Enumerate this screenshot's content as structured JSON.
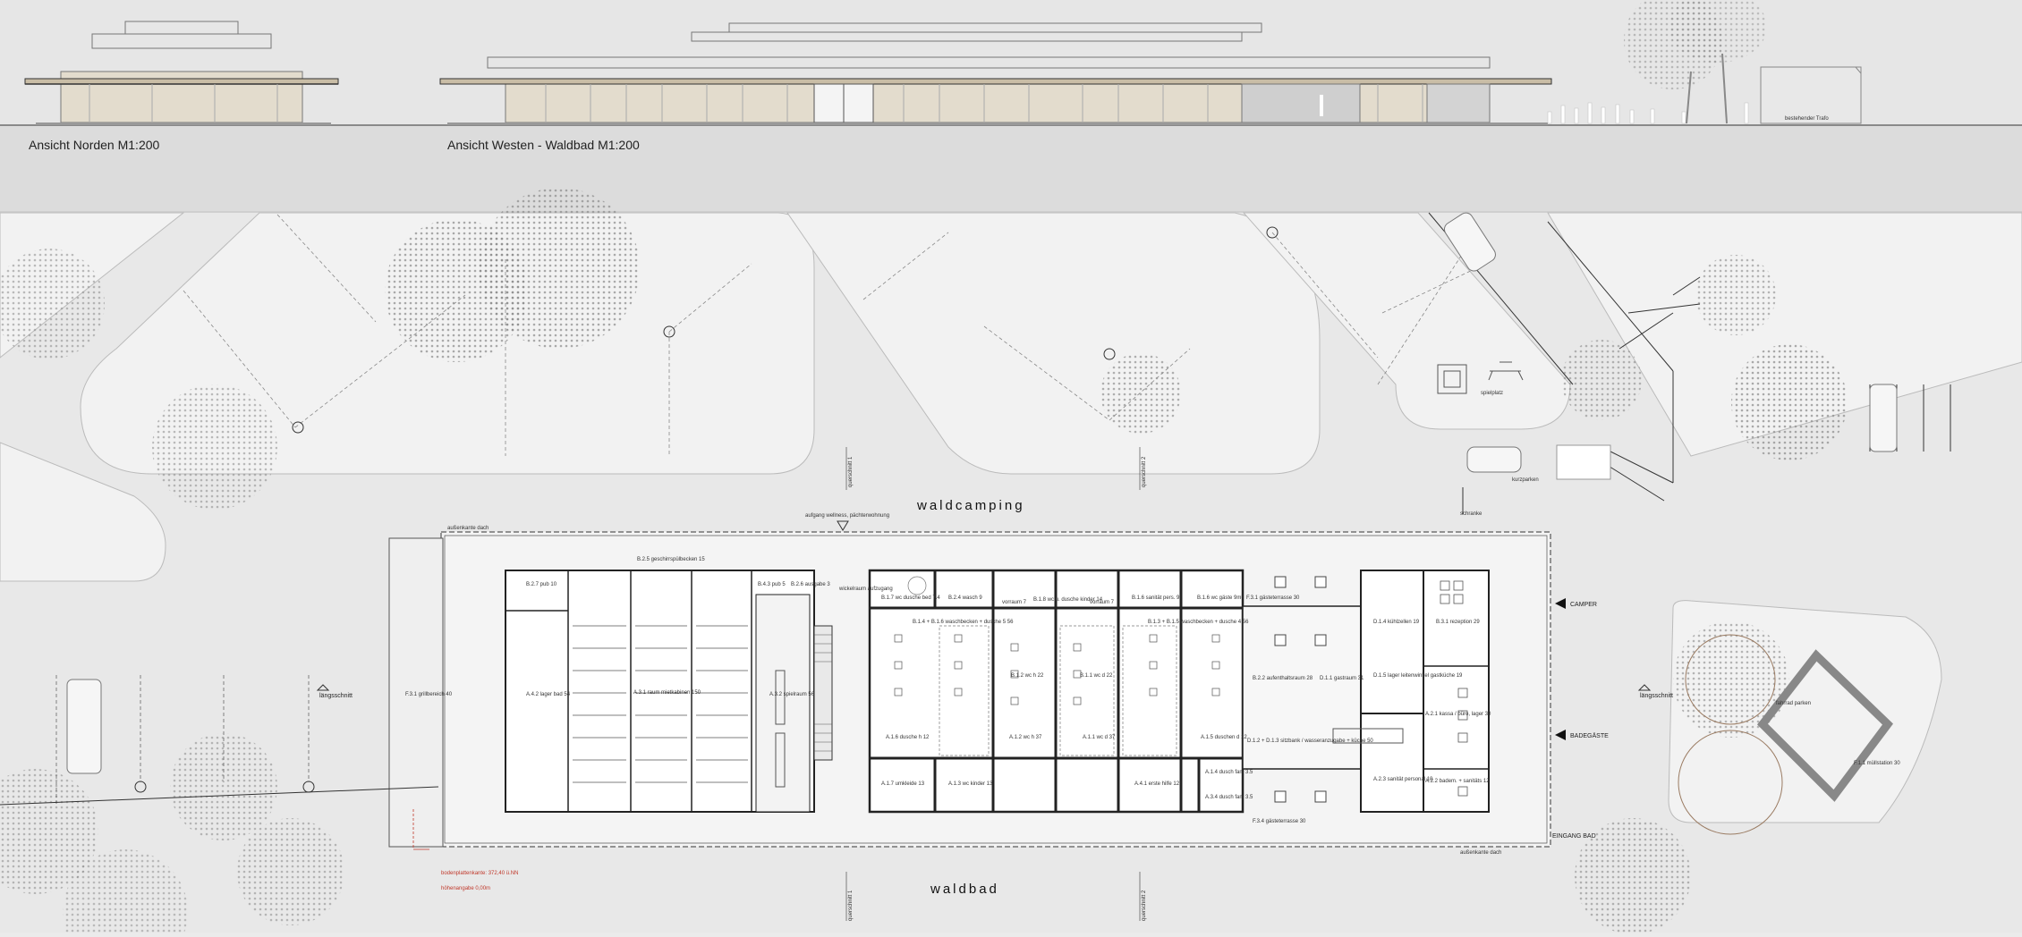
{
  "elevations": {
    "north_title": "Ansicht Norden  M1:200",
    "west_title": "Ansicht Westen - Waldbad  M1:200",
    "trafo_label": "bestehender Trafo"
  },
  "site": {
    "waldcamping": "waldcamping",
    "waldbad": "waldbad",
    "camper": "CAMPER",
    "badegaeste": "BADEGÄSTE",
    "eingang_bad": "EINGANG BAD",
    "aussenkante_top": "außenkante dach",
    "aussenkante_bottom": "außenkante dach",
    "zugang_label": "aufgang wellness, pächterwohnung",
    "schranke": "schranke",
    "spielplatz": "spielplatz",
    "kurzparken": "kurzparken",
    "laengsschnitt_left": "längsschnitt",
    "laengsschnitt_right": "längsschnitt",
    "querschnitt1_top": "querschnitt 1",
    "querschnitt2_top": "querschnitt 2",
    "querschnitt1_bottom": "querschnitt 1",
    "querschnitt2_bottom": "querschnitt 2",
    "red_note_1": "bodenplattenkante: 372,40 ü.NN",
    "red_note_2": "höhenangabe 0,00m"
  },
  "rooms": {
    "b27": "B.2.7 pub 10",
    "b25": "B.2.5 geschirrspülbecken 15",
    "b43": "B.4.3 pub 5",
    "b26": "B.2.6 ausgabe 3",
    "a42": "A.4.2 lager bad 54",
    "a31": "A.3.1 raum mietkabinen 150",
    "a32": "A.3.2 spielraum 56",
    "wickel": "wickelraum aufzugang",
    "b17": "B.1.7 wc dusche bed 7.4",
    "b24": "B.2.4 wasch 9",
    "vorraum1": "vorraum 7",
    "b18": "B.1.8 wc u. dusche kinder 14",
    "vorraum2": "vorraum 7",
    "b16": "B.1.6 sanität pers. 9",
    "b15": "B.1.6 wc gäste 9m²",
    "f31": "F.3.1 gästeterrasse 30",
    "b14": "B.1.4 + B.1.6 waschbecken + dusche 5 56",
    "b13": "B.1.3 + B.1.5 waschbecken + dusche 4 56",
    "b12": "B.1.2 wc h 22",
    "b11": "B.1.1 wc d 22",
    "a16": "A.1.6 dusche h 12",
    "a12": "A.1.2 wc h 37",
    "a11": "A.1.1 wc d 37",
    "a15": "A.1.5 duschen d 12",
    "a17": "A.1.7 umkleide 13",
    "a13": "A.1.3 wc kinder 13",
    "a41": "A.4.1 erste hilfe 12",
    "a14": "A.1.4 dusch fam 3.5",
    "a34": "A.3.4 dusch fam 3.5",
    "b22": "B.2.2 aufenthaltsraum 28",
    "d11": "D.1.1 gastraum 31",
    "d12": "D.1.2 + D.1.3 sitzbank / wasseranzugabe + küche 50",
    "d14": "D.1.4 kühlzellen 19",
    "b31": "B.3.1 rezeption 29",
    "d15": "D.1.5 lager leitenwinkel gastküche 19",
    "a21": "A.2.1 kassa / büro, lager 30",
    "a23": "A.2.3 sanität personal 10",
    "a22": "A.2.2 badem. + sanitäts 12",
    "f34": "F.3.4 gästeterrasse 30",
    "f11": "F.1.1 müllstation 30",
    "f31b": "F.3.1 grillbereich 40",
    "fahrrad": "fahrrad parken"
  }
}
